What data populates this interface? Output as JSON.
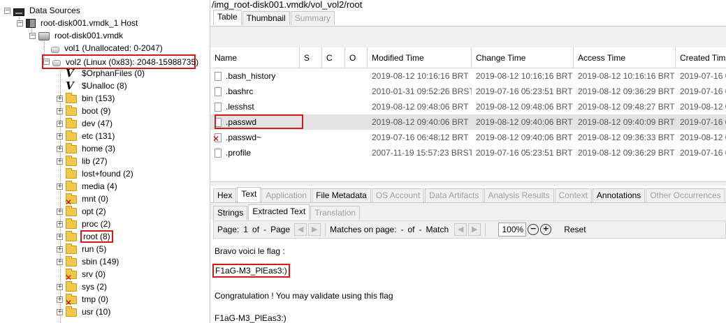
{
  "tree": {
    "root": "Data Sources",
    "host": "root-disk001.vmdk_1 Host",
    "image": "root-disk001.vmdk",
    "vol1": "vol1 (Unallocated: 0-2047)",
    "vol2": "vol2 (Linux (0x83): 2048-15988735)",
    "items": [
      {
        "label": "$OrphanFiles (0)",
        "icon": "virtual-folder-icon",
        "expander": false,
        "deleted": false
      },
      {
        "label": "$Unalloc (8)",
        "icon": "virtual-folder-icon",
        "expander": false,
        "deleted": false
      },
      {
        "label": "bin (153)",
        "icon": "folder-icon",
        "expander": true,
        "deleted": false
      },
      {
        "label": "boot (9)",
        "icon": "folder-icon",
        "expander": true,
        "deleted": false
      },
      {
        "label": "dev (47)",
        "icon": "folder-icon",
        "expander": true,
        "deleted": false
      },
      {
        "label": "etc (131)",
        "icon": "folder-icon",
        "expander": true,
        "deleted": false
      },
      {
        "label": "home (3)",
        "icon": "folder-icon",
        "expander": true,
        "deleted": false
      },
      {
        "label": "lib (27)",
        "icon": "folder-icon",
        "expander": true,
        "deleted": false
      },
      {
        "label": "lost+found (2)",
        "icon": "folder-icon",
        "expander": false,
        "deleted": false
      },
      {
        "label": "media (4)",
        "icon": "folder-icon",
        "expander": true,
        "deleted": false
      },
      {
        "label": "mnt (0)",
        "icon": "folder-icon",
        "expander": false,
        "deleted": true
      },
      {
        "label": "opt (2)",
        "icon": "folder-icon",
        "expander": true,
        "deleted": false
      },
      {
        "label": "proc (2)",
        "icon": "folder-icon",
        "expander": true,
        "deleted": false
      },
      {
        "label": "root (8)",
        "icon": "folder-icon",
        "expander": true,
        "deleted": false
      },
      {
        "label": "run (5)",
        "icon": "folder-icon",
        "expander": true,
        "deleted": false
      },
      {
        "label": "sbin (149)",
        "icon": "folder-icon",
        "expander": true,
        "deleted": false
      },
      {
        "label": "srv (0)",
        "icon": "folder-icon",
        "expander": false,
        "deleted": true
      },
      {
        "label": "sys (2)",
        "icon": "folder-icon",
        "expander": true,
        "deleted": false
      },
      {
        "label": "tmp (0)",
        "icon": "folder-icon",
        "expander": true,
        "deleted": true
      },
      {
        "label": "usr (10)",
        "icon": "folder-icon",
        "expander": true,
        "deleted": false
      }
    ]
  },
  "path": "/img_root-disk001.vmdk/vol_vol2/root",
  "top_tabs": [
    {
      "label": "Table",
      "active": true,
      "disabled": false
    },
    {
      "label": "Thumbnail",
      "active": false,
      "disabled": false
    },
    {
      "label": "Summary",
      "active": false,
      "disabled": true
    }
  ],
  "table": {
    "headers": [
      "Name",
      "S",
      "C",
      "O",
      "Modified Time",
      "Change Time",
      "Access Time",
      "Created Tim"
    ],
    "rows": [
      {
        "name": ".bash_history",
        "deleted": false,
        "selected": false,
        "modified": "2019-08-12 10:16:16 BRT",
        "change": "2019-08-12 10:16:16 BRT",
        "access": "2019-08-12 10:16:16 BRT",
        "created": "2019-07-16 0"
      },
      {
        "name": ".bashrc",
        "deleted": false,
        "selected": false,
        "modified": "2010-01-31 09:52:26 BRST",
        "change": "2019-07-16 05:23:51 BRT",
        "access": "2019-08-12 09:36:29 BRT",
        "created": "2019-07-16 0"
      },
      {
        "name": ".lesshst",
        "deleted": false,
        "selected": false,
        "modified": "2019-08-12 09:48:06 BRT",
        "change": "2019-08-12 09:48:06 BRT",
        "access": "2019-08-12 09:48:27 BRT",
        "created": "2019-08-12 0"
      },
      {
        "name": ".passwd",
        "deleted": false,
        "selected": true,
        "modified": "2019-08-12 09:40:06 BRT",
        "change": "2019-08-12 09:40:06 BRT",
        "access": "2019-08-12 09:40:09 BRT",
        "created": "2019-07-16 0"
      },
      {
        "name": ".passwd~",
        "deleted": true,
        "selected": false,
        "modified": "2019-07-16 06:48:12 BRT",
        "change": "2019-08-12 09:40:06 BRT",
        "access": "2019-08-12 09:36:33 BRT",
        "created": "2019-08-12 0"
      },
      {
        "name": ".profile",
        "deleted": false,
        "selected": false,
        "modified": "2007-11-19 15:57:23 BRST",
        "change": "2019-07-16 05:23:51 BRT",
        "access": "2019-08-12 09:36:29 BRT",
        "created": "2019-07-16 0"
      }
    ]
  },
  "viewer_tabs": [
    {
      "label": "Hex",
      "active": false,
      "disabled": false
    },
    {
      "label": "Text",
      "active": true,
      "disabled": false
    },
    {
      "label": "Application",
      "active": false,
      "disabled": true
    },
    {
      "label": "File Metadata",
      "active": false,
      "disabled": false
    },
    {
      "label": "OS Account",
      "active": false,
      "disabled": true
    },
    {
      "label": "Data Artifacts",
      "active": false,
      "disabled": true
    },
    {
      "label": "Analysis Results",
      "active": false,
      "disabled": true
    },
    {
      "label": "Context",
      "active": false,
      "disabled": true
    },
    {
      "label": "Annotations",
      "active": false,
      "disabled": false
    },
    {
      "label": "Other Occurrences",
      "active": false,
      "disabled": true
    }
  ],
  "text_tabs": [
    {
      "label": "Strings",
      "active": false,
      "disabled": false
    },
    {
      "label": "Extracted Text",
      "active": true,
      "disabled": false
    },
    {
      "label": "Translation",
      "active": false,
      "disabled": true
    }
  ],
  "toolbar": {
    "page_label": "Page:",
    "page_num": "1",
    "of_label": "of",
    "page_total": "-",
    "page_word": "Page",
    "matches_label": "Matches on page:",
    "match_num": "-",
    "match_of": "of",
    "match_total": "-",
    "match_word": "Match",
    "zoom": "100%",
    "reset": "Reset"
  },
  "content": {
    "line1": "Bravo voici le flag :",
    "line2": "F1aG-M3_PlEas3:)",
    "line3": "Congratulation ! You may validate using this flag",
    "line4": "F1aG-M3_PlEas3:)"
  },
  "colors": {
    "highlight": "#d11a1a",
    "folder": "#f2c84b",
    "selected_row": "#e3e3e3",
    "panel_gray": "#f0f0f0"
  }
}
